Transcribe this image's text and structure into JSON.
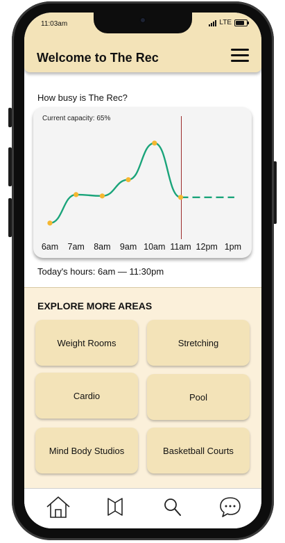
{
  "status_bar": {
    "time": "11:03am",
    "network": "LTE"
  },
  "header": {
    "title": "Welcome to The Rec",
    "menu_icon": "hamburger-menu-icon"
  },
  "busy": {
    "question": "How busy is The Rec?",
    "capacity_label": "Current capacity: 65%",
    "hours": "Today's hours: 6am — 11:30pm"
  },
  "chart_data": {
    "type": "line",
    "categories": [
      "6am",
      "7am",
      "8am",
      "9am",
      "10am",
      "11am",
      "12pm",
      "1pm"
    ],
    "values": [
      17,
      38,
      37,
      49,
      76,
      36
    ],
    "forecast_values": [
      36,
      36,
      36
    ],
    "current_marker": "11am",
    "current_capacity_percent": 65,
    "colors": {
      "line": "#1aa47a",
      "point": "#f5b731",
      "current_line": "#9a2b2b"
    }
  },
  "explore": {
    "title": "EXPLORE MORE AREAS",
    "areas": [
      {
        "label": "Weight Rooms"
      },
      {
        "label": "Stretching"
      },
      {
        "label": "Cardio"
      },
      {
        "label": "Pool"
      },
      {
        "label": "Mind Body Studios"
      },
      {
        "label": "Basketball Courts"
      }
    ]
  },
  "tabbar": {
    "items": [
      {
        "icon": "home-icon"
      },
      {
        "icon": "map-icon"
      },
      {
        "icon": "search-icon"
      },
      {
        "icon": "chat-icon"
      }
    ]
  },
  "colors": {
    "accent": "#f3e3b8",
    "section_bg": "#fbf0da"
  }
}
